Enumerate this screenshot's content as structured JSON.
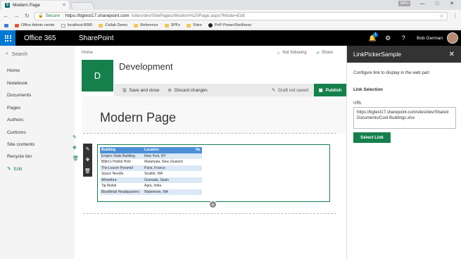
{
  "browser": {
    "tab_title": "Modern Page",
    "tab_close": "×",
    "profile_chip": "SPFx",
    "window_buttons": [
      "—",
      "□",
      "✕"
    ],
    "secure_label": "Secure",
    "url_host": "https://bgtest17.sharepoint.com",
    "url_path": "/sites/dev/SitePages/Modern%20Page.aspx?Mode=Edit",
    "bookmarks": [
      {
        "label": "Office Admin center",
        "icon": "office-icon"
      },
      {
        "label": "localhost:8080",
        "icon": "page-icon"
      },
      {
        "label": "Collab Demo",
        "icon": "folder-icon"
      },
      {
        "label": "Reference",
        "icon": "folder-icon"
      },
      {
        "label": "SPFx",
        "icon": "folder-icon"
      },
      {
        "label": "Shire",
        "icon": "folder-icon"
      },
      {
        "label": "PnP-PowerShell/reso",
        "icon": "github-icon"
      }
    ]
  },
  "suite": {
    "product": "Office 365",
    "app": "SharePoint",
    "notification_count": "1",
    "user_name": "Bob German"
  },
  "leftnav": {
    "search_placeholder": "Search",
    "items": [
      "Home",
      "Notebook",
      "Documents",
      "Pages",
      "Authors",
      "Curtisms",
      "Site contents",
      "Recycle bin"
    ],
    "edit_label": "Edit"
  },
  "header": {
    "breadcrumb": "Home",
    "not_following": "Not following",
    "share": "Share",
    "site_initial": "D",
    "site_title": "Development"
  },
  "commands": {
    "save_and_close": "Save and close",
    "discard": "Discard changes",
    "draft_status": "Draft not saved",
    "publish": "Publish"
  },
  "page": {
    "title": "Modern Page"
  },
  "table": {
    "headers": [
      "Building",
      "Location",
      "He"
    ],
    "rows": [
      [
        "Empire State Building",
        "New York, NY"
      ],
      [
        "Bilbo's Hobbit Hole",
        "Matamata, New Zealand"
      ],
      [
        "The Louvre Pyramid",
        "Paris, France"
      ],
      [
        "Space Needle",
        "Seattle, WA"
      ],
      [
        "Alhambra",
        "Granada, Spain"
      ],
      [
        "Taj Mahal",
        "Agra, India"
      ],
      [
        "BlueMetal Headquarters",
        "Watertown, MA"
      ]
    ]
  },
  "panel": {
    "title": "LinkPickerSample",
    "description": "Configure link to display in the web part",
    "section_label": "Link Selection",
    "url_label": "URL",
    "url_value": "https://bgtest17.sharepoint.com/sites/dev/Shared Documents/Cool Buildings.xlsx",
    "select_button": "Select Link"
  },
  "colors": {
    "accent": "#15804c",
    "suite_bg": "#000000",
    "waffle": "#0078d4",
    "table_header": "#4c8fd6"
  }
}
